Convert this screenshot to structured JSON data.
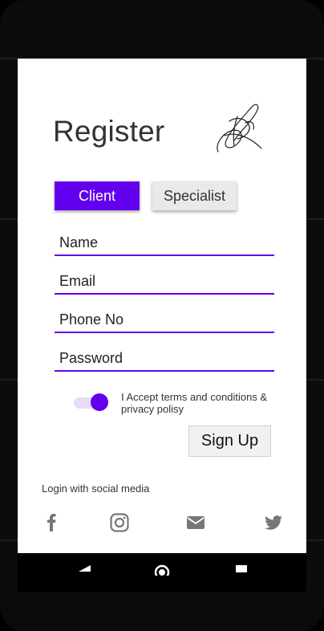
{
  "form": {
    "title": "Register",
    "tabs": {
      "client": "Client",
      "specialist": "Specialist"
    },
    "fields": {
      "name_placeholder": "Name",
      "email_placeholder": "Email",
      "phone_placeholder": "Phone No",
      "password_placeholder": "Password"
    },
    "terms_toggle_on": true,
    "terms_text": "I Accept terms and conditions & privacy polisy",
    "signup_label": "Sign Up"
  },
  "social": {
    "label": "Login with social media",
    "icons": [
      "facebook-icon",
      "instagram-icon",
      "mail-icon",
      "twitter-icon"
    ]
  },
  "system_nav": {
    "icons": [
      "back-icon",
      "home-icon",
      "recents-icon"
    ]
  },
  "colors": {
    "accent": "#6200ee",
    "accent_light": "#e6dcf7",
    "secondary_button": "#e9e9e9",
    "icon_gray": "#777777"
  }
}
